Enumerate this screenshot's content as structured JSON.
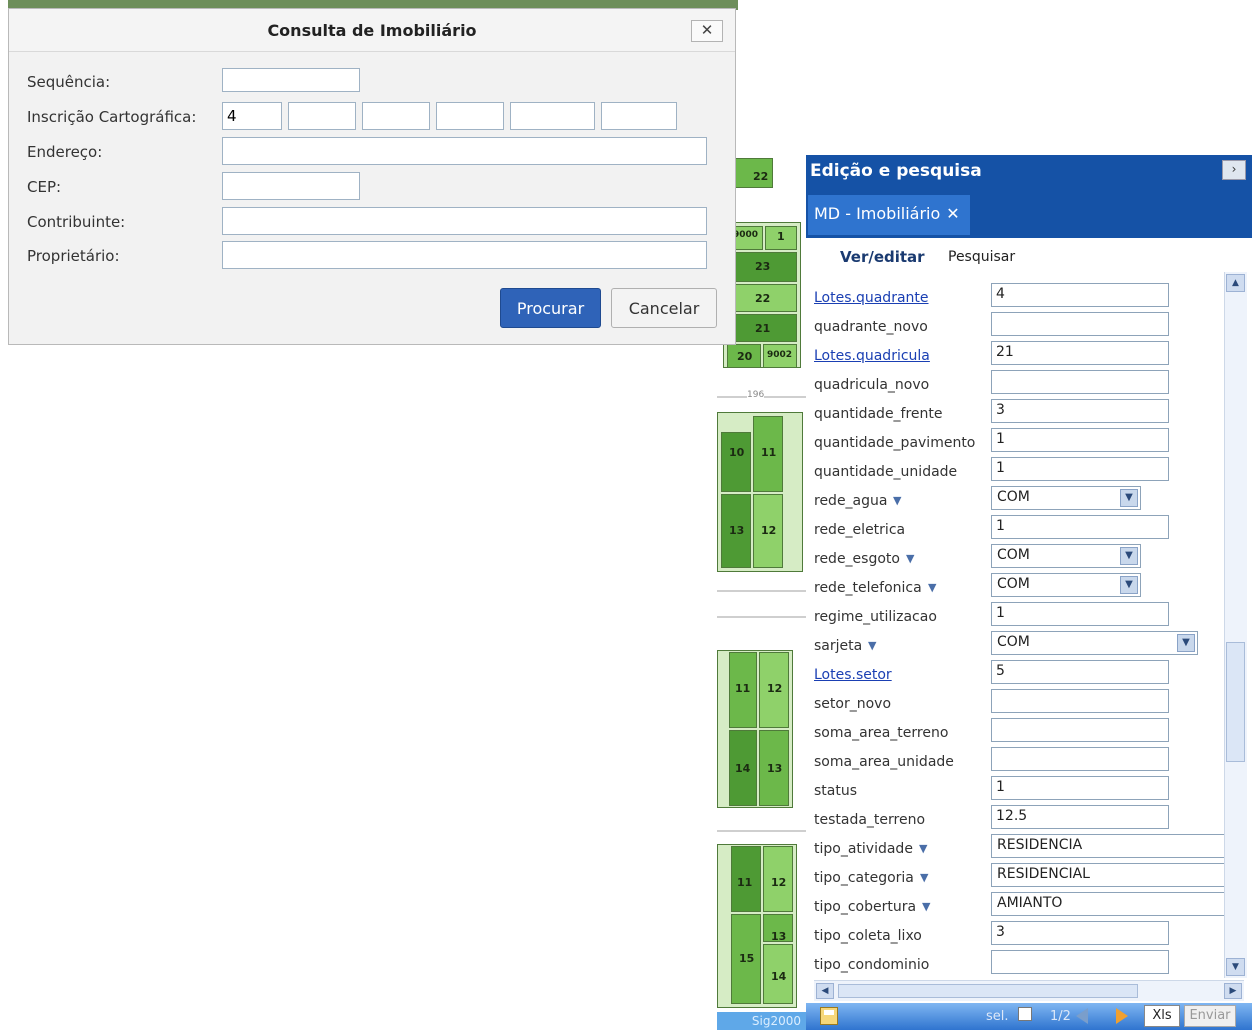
{
  "query_dialog": {
    "title": "Consulta de Imobiliário",
    "close": "✕",
    "fields": {
      "sequencia_label": "Sequência:",
      "inscricao_label": "Inscrição Cartográfica:",
      "inscricao_values": [
        "4",
        "",
        "",
        "",
        "",
        ""
      ],
      "endereco_label": "Endereço:",
      "cep_label": "CEP:",
      "contribuinte_label": "Contribuinte:",
      "proprietario_label": "Proprietário:"
    },
    "buttons": {
      "search": "Procurar",
      "cancel": "Cancelar"
    }
  },
  "edit_panel": {
    "title": "Edição e pesquisa",
    "collapse_glyph": "›",
    "tab": {
      "label": "MD - Imobiliário",
      "close": "✕"
    },
    "subtabs": {
      "view_edit": "Ver/editar",
      "search": "Pesquisar"
    },
    "rows": [
      {
        "name": "Lotes.quadrante",
        "value": "4",
        "link": true
      },
      {
        "name": "quadrante_novo",
        "value": ""
      },
      {
        "name": "Lotes.quadricula",
        "value": "21",
        "link": true
      },
      {
        "name": "quadricula_novo",
        "value": ""
      },
      {
        "name": "quantidade_frente",
        "value": "3"
      },
      {
        "name": "quantidade_pavimento",
        "value": "1"
      },
      {
        "name": "quantidade_unidade",
        "value": "1"
      },
      {
        "name": "rede_agua",
        "value": "COM",
        "select": true
      },
      {
        "name": "rede_eletrica",
        "value": "1"
      },
      {
        "name": "rede_esgoto",
        "value": "COM",
        "select": true
      },
      {
        "name": "rede_telefonica",
        "value": "COM",
        "select": true
      },
      {
        "name": "regime_utilizacao",
        "value": "1"
      },
      {
        "name": "sarjeta",
        "value": "COM",
        "select": true,
        "wide": true
      },
      {
        "name": "Lotes.setor",
        "value": "5",
        "link": true
      },
      {
        "name": "setor_novo",
        "value": ""
      },
      {
        "name": "soma_area_terreno",
        "value": ""
      },
      {
        "name": "soma_area_unidade",
        "value": ""
      },
      {
        "name": "status",
        "value": "1"
      },
      {
        "name": "testada_terreno",
        "value": "12.5"
      },
      {
        "name": "tipo_atividade",
        "value": "RESIDENCIA",
        "filter": true
      },
      {
        "name": "tipo_categoria",
        "value": "RESIDENCIAL",
        "filter": true
      },
      {
        "name": "tipo_cobertura",
        "value": "AMIANTO",
        "filter": true
      },
      {
        "name": "tipo_coleta_lixo",
        "value": "3"
      },
      {
        "name": "tipo_condominio",
        "value": ""
      }
    ],
    "toolbar": {
      "sel_label": "sel.",
      "page": "1/2",
      "xls": "Xls",
      "send": "Enviar"
    }
  },
  "map": {
    "labels": [
      "22",
      "9000",
      "1",
      "23",
      "22",
      "21",
      "20",
      "9002",
      "196",
      "10",
      "11",
      "13",
      "12",
      "11",
      "12",
      "14",
      "13",
      "11",
      "12",
      "13",
      "15",
      "14"
    ],
    "footer": "Sig2000"
  },
  "colors": {
    "panel_blue": "#1552a6",
    "primary_button": "#2f63b8",
    "lot_green": "#8fd16a"
  },
  "icons": [
    "close-icon",
    "collapse-icon",
    "dropdown-arrow-icon",
    "filter-arrow-icon",
    "save-icon",
    "prev-page-icon",
    "next-page-icon"
  ]
}
